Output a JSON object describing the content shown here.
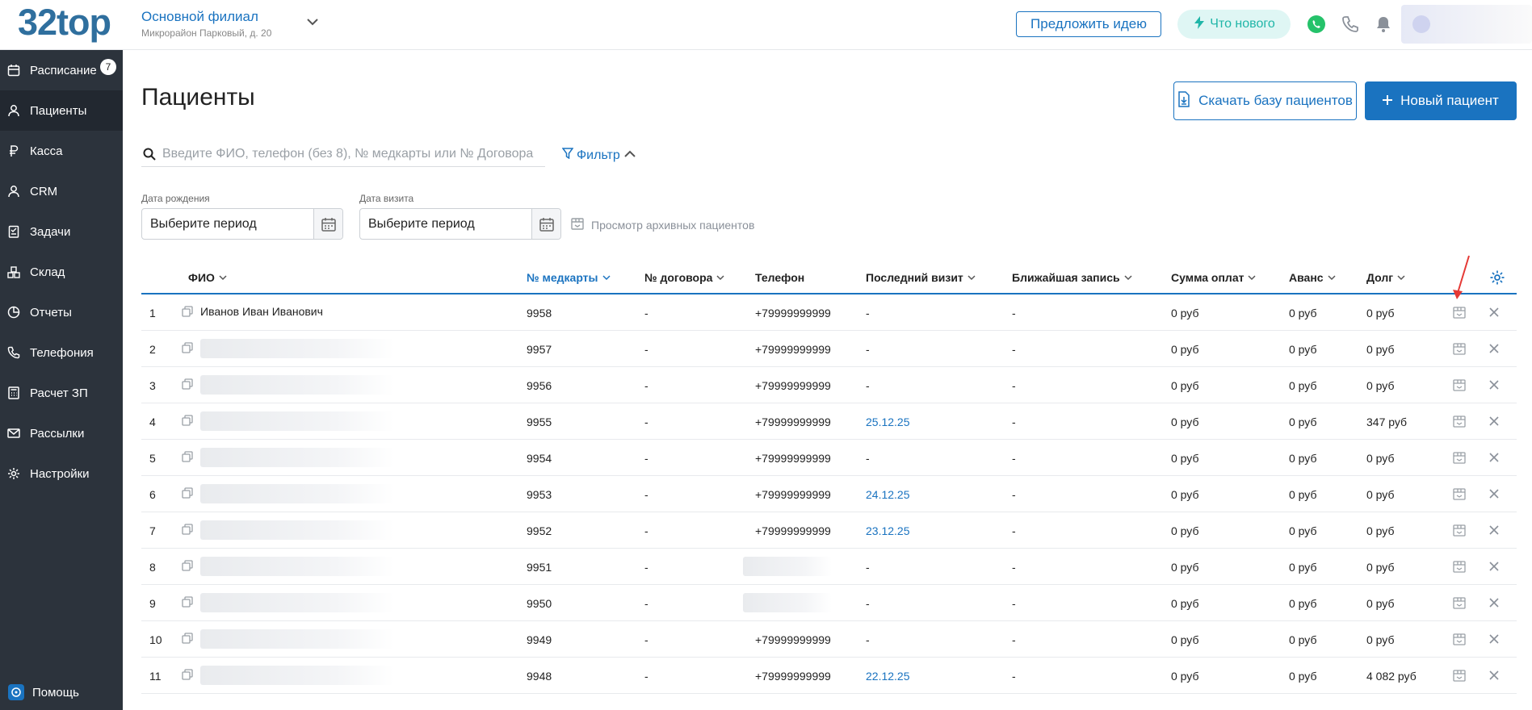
{
  "app": {
    "logo": "32top",
    "branch_name": "Основной филиал",
    "branch_address": "Микрорайон Парковый, д. 20",
    "idea_button": "Предложить идею",
    "whats_new_button": "Что нового",
    "accent": "#1a73c0",
    "sidebar_bg": "#2c333c"
  },
  "sidebar": {
    "items": [
      {
        "label": "Расписание",
        "icon": "calendar-icon",
        "badge": "7"
      },
      {
        "label": "Пациенты",
        "icon": "person-icon"
      },
      {
        "label": "Касса",
        "icon": "ruble-icon"
      },
      {
        "label": "CRM",
        "icon": "person-icon"
      },
      {
        "label": "Задачи",
        "icon": "task-icon"
      },
      {
        "label": "Склад",
        "icon": "boxes-icon"
      },
      {
        "label": "Отчеты",
        "icon": "pie-chart-icon"
      },
      {
        "label": "Телефония",
        "icon": "phone-icon"
      },
      {
        "label": "Расчет ЗП",
        "icon": "calculator-icon"
      },
      {
        "label": "Рассылки",
        "icon": "mail-icon"
      },
      {
        "label": "Настройки",
        "icon": "gear-icon"
      }
    ],
    "help": "Помощь"
  },
  "main": {
    "title": "Пациенты",
    "download_button": "Скачать базу пациентов",
    "add_button": "Новый пациент",
    "search_placeholder": "Введите ФИО, телефон (без 8), № медкарты или № Договора",
    "filter_label": "Фильтр",
    "birth_label": "Дата рождения",
    "birth_value": "Выберите период",
    "visit_label": "Дата визита",
    "visit_value": "Выберите период",
    "archive_link": "Просмотр архивных пациентов"
  },
  "table": {
    "headers": {
      "fio": "ФИО",
      "card": "№ медкарты",
      "contract": "№ договора",
      "phone": "Телефон",
      "last_visit": "Последний визит",
      "next": "Ближайшая запись",
      "paid": "Сумма оплат",
      "advance": "Аванс",
      "debt": "Долг"
    },
    "rows": [
      {
        "n": "1",
        "name": "Иванов Иван Иванович",
        "card": "9958",
        "contract": "-",
        "phone": "+79999999999",
        "last": "-",
        "next": "-",
        "paid": "0 руб",
        "adv": "0 руб",
        "debt": "0 руб"
      },
      {
        "n": "2",
        "name": "",
        "card": "9957",
        "contract": "-",
        "phone": "+79999999999",
        "last": "-",
        "next": "-",
        "paid": "0 руб",
        "adv": "0 руб",
        "debt": "0 руб"
      },
      {
        "n": "3",
        "name": "",
        "card": "9956",
        "contract": "-",
        "phone": "+79999999999",
        "last": "-",
        "next": "-",
        "paid": "0 руб",
        "adv": "0 руб",
        "debt": "0 руб"
      },
      {
        "n": "4",
        "name": "",
        "card": "9955",
        "contract": "-",
        "phone": "+79999999999",
        "last": "25.12.25",
        "next": "-",
        "paid": "0 руб",
        "adv": "0 руб",
        "debt": "347 руб"
      },
      {
        "n": "5",
        "name": "",
        "card": "9954",
        "contract": "-",
        "phone": "+79999999999",
        "last": "-",
        "next": "-",
        "paid": "0 руб",
        "adv": "0 руб",
        "debt": "0 руб"
      },
      {
        "n": "6",
        "name": "",
        "card": "9953",
        "contract": "-",
        "phone": "+79999999999",
        "last": "24.12.25",
        "next": "-",
        "paid": "0 руб",
        "adv": "0 руб",
        "debt": "0 руб"
      },
      {
        "n": "7",
        "name": "",
        "card": "9952",
        "contract": "-",
        "phone": "+79999999999",
        "last": "23.12.25",
        "next": "-",
        "paid": "0 руб",
        "adv": "0 руб",
        "debt": "0 руб"
      },
      {
        "n": "8",
        "name": "",
        "card": "9951",
        "contract": "-",
        "phone": "",
        "last": "-",
        "next": "-",
        "paid": "0 руб",
        "adv": "0 руб",
        "debt": "0 руб"
      },
      {
        "n": "9",
        "name": "",
        "card": "9950",
        "contract": "-",
        "phone": "",
        "last": "-",
        "next": "-",
        "paid": "0 руб",
        "adv": "0 руб",
        "debt": "0 руб"
      },
      {
        "n": "10",
        "name": "",
        "card": "9949",
        "contract": "-",
        "phone": "+79999999999",
        "last": "-",
        "next": "-",
        "paid": "0 руб",
        "adv": "0 руб",
        "debt": "0 руб"
      },
      {
        "n": "11",
        "name": "",
        "card": "9948",
        "contract": "-",
        "phone": "+79999999999",
        "last": "22.12.25",
        "next": "-",
        "paid": "0 руб",
        "adv": "0 руб",
        "debt": "4 082 руб"
      }
    ]
  }
}
